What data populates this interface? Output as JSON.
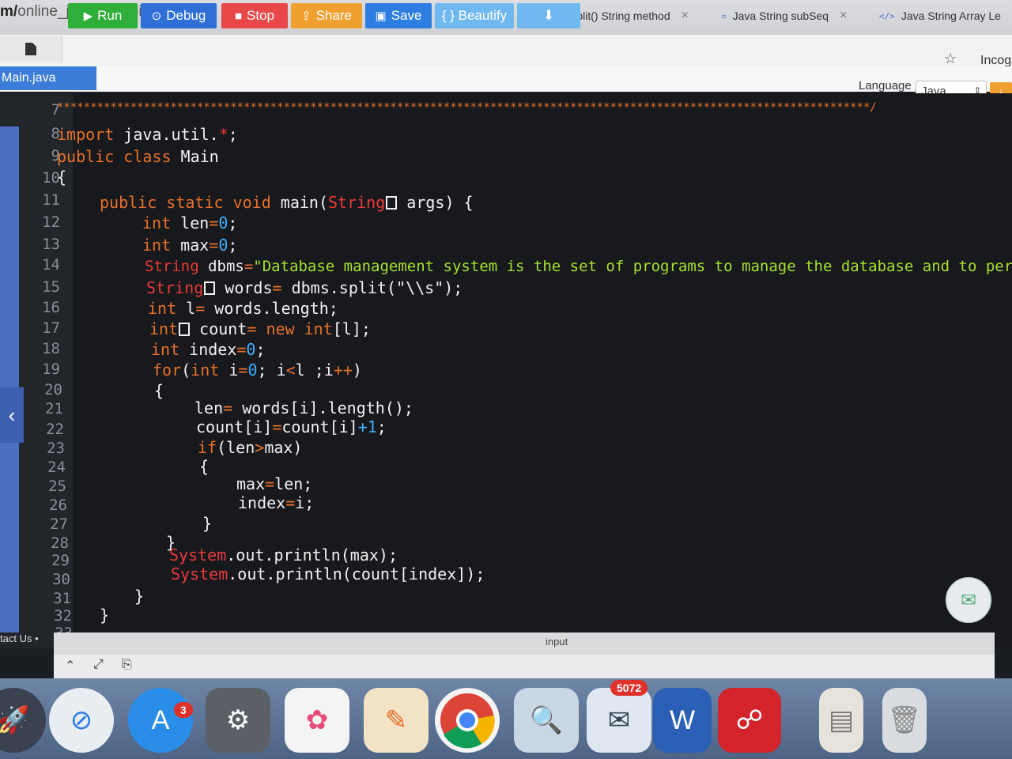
{
  "browser": {
    "url_prefix": "m/",
    "url_path": "online_java_compiler",
    "tabs": [
      {
        "label": "Split() String method",
        "close": "×"
      },
      {
        "label": "Java String subSeq",
        "close": "×"
      },
      {
        "label": "Java String Array Le",
        "icon": "</>"
      }
    ],
    "incognito": "Incog"
  },
  "toolbar": {
    "run": "Run",
    "debug": "Debug",
    "stop": "Stop",
    "share": "Share",
    "save": "Save",
    "beautify": "{ } Beautify",
    "colors": {
      "run": "#2fae3a",
      "debug": "#2f6fd6",
      "stop": "#e8484a",
      "share": "#f0a030",
      "save": "#2d7ee0",
      "beautify": "#6fb9f0",
      "download": "#6fb9f0"
    }
  },
  "file_tab": "Main.java",
  "language": {
    "label": "Language",
    "value": "Java"
  },
  "editor": {
    "line_numbers": [
      "7",
      "8",
      "9",
      "10",
      "11",
      "12",
      "13",
      "14",
      "15",
      "16",
      "17",
      "18",
      "19",
      "20",
      "21",
      "22",
      "23",
      "24",
      "25",
      "26",
      "27",
      "28",
      "29",
      "30",
      "31",
      "32",
      "33"
    ],
    "stars": "**************************************************************************************************************************/",
    "lines": {
      "l8_kw": "import",
      "l8_rest": " java.util.",
      "l8_star": "*",
      "l8_end": ";",
      "l9_kw": "public class",
      "l9_rest": " Main",
      "l10": "{",
      "l11_kw": "public static void",
      "l11_rest": " main(",
      "l11_ty": "String",
      "l11_end": " args) {",
      "l12_kw": "int",
      "l12_rest": " len",
      "l12_op": "=",
      "l12_num": "0",
      "l12_end": ";",
      "l13_kw": "int",
      "l13_rest": " max",
      "l13_op": "=",
      "l13_num": "0",
      "l13_end": ";",
      "l14_kw": "String",
      "l14_rest": " dbms",
      "l14_op": "=",
      "l14_str": "\"Database management system is the set of programs to manage the database and to perform",
      "l15_kw": "String",
      "l15_rest": " words",
      "l15_op": "=",
      "l15_end": " dbms.split(\"\\\\s\");",
      "l16_kw": "int",
      "l16_rest": " l",
      "l16_op": "=",
      "l16_end": " words.length;",
      "l17_kw": "int",
      "l17_rest": " count",
      "l17_op": "=",
      "l17_new": " new int",
      "l17_end": "[l];",
      "l18_kw": "int",
      "l18_rest": " index",
      "l18_op": "=",
      "l18_num": "0",
      "l18_end": ";",
      "l19_kw": "for",
      "l19_a": "(",
      "l19_int": "int",
      "l19_b": " i",
      "l19_op": "=",
      "l19_num": "0",
      "l19_c": "; i",
      "l19_lt": "<",
      "l19_d": "l ;i",
      "l19_pp": "++",
      "l19_e": ")",
      "l20": "{",
      "l21_a": "len",
      "l21_op": "=",
      "l21_b": " words[i].length();",
      "l22_a": "count[i]",
      "l22_op": "=",
      "l22_b": "count[i]",
      "l22_plus": "+1",
      "l22_c": ";",
      "l23_kw": "if",
      "l23_a": "(len",
      "l23_gt": ">",
      "l23_b": "max)",
      "l24": "{",
      "l25_a": "max",
      "l25_op": "=",
      "l25_b": "len;",
      "l26_a": "index",
      "l26_op": "=",
      "l26_b": "i;",
      "l27": "}",
      "l28": "}",
      "l29_sys": "System",
      "l29_rest": ".out.println(max);",
      "l30_sys": "System",
      "l30_rest": ".out.println(count[index]);",
      "l31": "}",
      "l32": "}"
    }
  },
  "sidebar": {
    "collapse_icon": "‹",
    "contact": "tact Us •"
  },
  "input_panel": {
    "label": "input"
  },
  "dock": {
    "items": [
      {
        "name": "Launchpad"
      },
      {
        "name": "Safari"
      },
      {
        "name": "App Store",
        "badge": "3"
      },
      {
        "name": "System Preferences"
      },
      {
        "name": "Photos"
      },
      {
        "name": "Pages"
      },
      {
        "name": "Chrome"
      },
      {
        "name": "Preview"
      },
      {
        "name": "Mail",
        "badge": "5072"
      },
      {
        "name": "Word"
      },
      {
        "name": "Mendeley"
      },
      {
        "name": "Documents"
      },
      {
        "name": "Trash"
      }
    ]
  }
}
